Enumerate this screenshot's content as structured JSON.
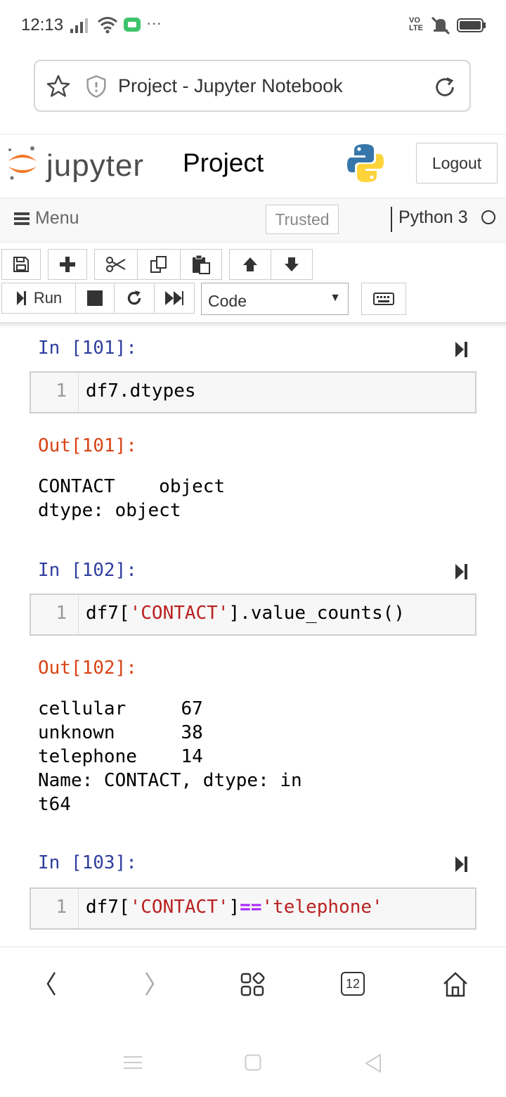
{
  "status_bar": {
    "time": "12:13",
    "volte": "VO\nLTE"
  },
  "browser": {
    "page_title": "Project - Jupyter Notebook",
    "tab_count": "12"
  },
  "header": {
    "logo_text": "jupyter",
    "notebook_name": "Project",
    "logout_label": "Logout"
  },
  "menubar": {
    "menu_label": "Menu",
    "trusted_label": "Trusted",
    "kernel_name": "Python 3"
  },
  "toolbar": {
    "run_label": "Run",
    "cell_type": "Code"
  },
  "cells": [
    {
      "in_prompt": "In [101]:",
      "line_no": "1",
      "code": "df7.dtypes",
      "out_prompt": "Out[101]:",
      "output": "CONTACT    object\ndtype: object"
    },
    {
      "in_prompt": "In [102]:",
      "line_no": "1",
      "code_parts": [
        "df7[",
        "'CONTACT'",
        "].value_counts()"
      ],
      "out_prompt": "Out[102]:",
      "output": "cellular     67\nunknown      38\ntelephone    14\nName: CONTACT, dtype: in\nt64"
    },
    {
      "in_prompt": "In [103]:",
      "line_no": "1",
      "code_parts": [
        "df7[",
        "'CONTACT'",
        "]",
        "==",
        "'telephone'"
      ]
    }
  ],
  "colors": {
    "in_prompt": "#303f9f",
    "out_prompt": "#d84315",
    "string": "#ba2121",
    "operator": "#aa22ff",
    "jupyter_orange": "#f37726"
  }
}
